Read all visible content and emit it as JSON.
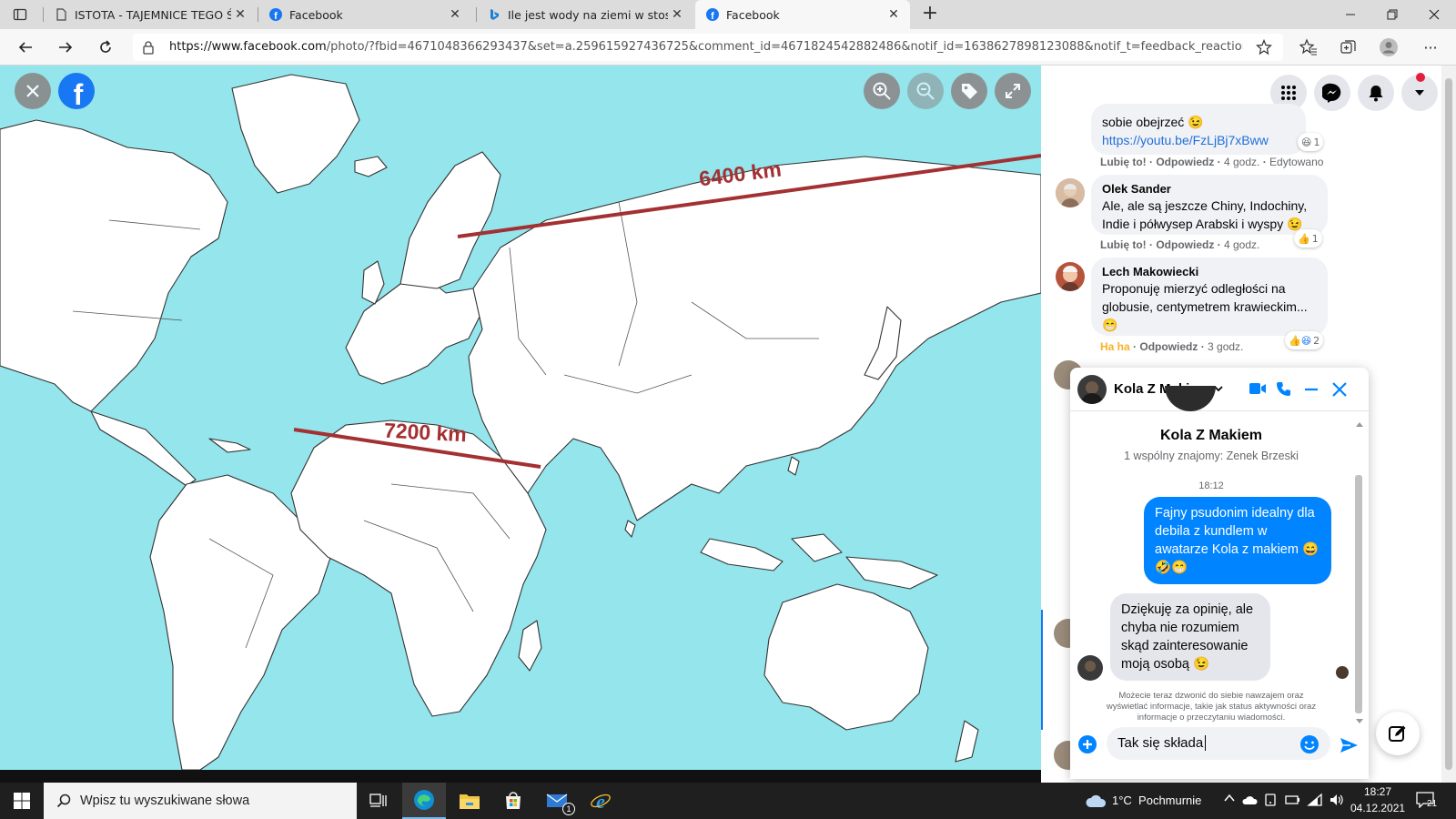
{
  "browser": {
    "tabs": [
      {
        "title": "ISTOTA - TAJEMNICE TEGO ŚWIA",
        "icon": "page-icon",
        "active": false
      },
      {
        "title": "Facebook",
        "icon": "facebook-icon",
        "active": false
      },
      {
        "title": "Ile jest wody na ziemi w stosunku",
        "icon": "bing-icon",
        "active": false
      },
      {
        "title": "Facebook",
        "icon": "facebook-icon",
        "active": true
      }
    ],
    "url_domain": "https://www.facebook.com",
    "url_path": "/photo/?fbid=4671048366293437&set=a.259615927436725&comment_id=4671824542882486&notif_id=1638627898123088&notif_t=feedback_reaction_generic..."
  },
  "photo": {
    "label_north": "6400 km",
    "label_south": "7200 km",
    "line_color": "#a33032",
    "ocean_color": "#94e5ec"
  },
  "comments": {
    "first": {
      "text": "sobie obejrzeć 😉",
      "link": "https://youtu.be/FzLjBj7xBww",
      "reaction_count": "1",
      "like": "Lubię to!",
      "reply": "Odpowiedz",
      "time": "4 godz.",
      "edited": "Edytowano"
    },
    "olek": {
      "author": "Olek Sander",
      "text": "Ale, ale są jeszcze Chiny, Indochiny, Indie i półwysep Arabski i wyspy 😉",
      "reaction_count": "1",
      "like": "Lubię to!",
      "reply": "Odpowiedz",
      "time": "4 godz."
    },
    "lech": {
      "author": "Lech Makowiecki",
      "text": "Proponuję mierzyć odległości na globusie, centymetrem krawieckim... 😁",
      "reaction_count": "2",
      "like": "Ha ha",
      "reply": "Odpowiedz",
      "time": "3 godz."
    }
  },
  "chat": {
    "name": "Kola Z Makiem",
    "mutual": "1 wspólny znajomy: Zenek Brzeski",
    "time": "18:12",
    "msg_me": "Fajny psudonim idealny dla debila z kundlem w awatarze Kola z makiem 😄🤣😁",
    "msg_them": "Dziękuję za opinię, ale chyba nie rozumiem skąd zainteresowanie moją osobą 😉",
    "notice": "Możecie teraz dzwonić do siebie nawzajem oraz wyświetlać informacje, takie jak status aktywności oraz informacje o przeczytaniu wiadomości.",
    "input": "Tak się składa"
  },
  "taskbar": {
    "search_placeholder": "Wpisz tu wyszukiwane słowa",
    "weather": "1°C  Pochmurnie",
    "time": "18:27",
    "date": "04.12.2021",
    "notification_count": "21",
    "mail_badge": "1"
  }
}
